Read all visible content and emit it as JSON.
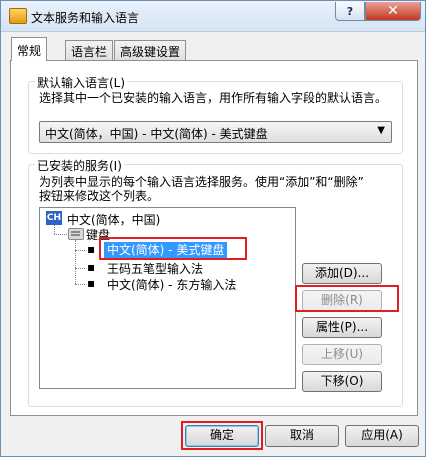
{
  "window": {
    "title": "文本服务和输入语言",
    "help_label": "?",
    "close_label": "✕"
  },
  "tabs": [
    {
      "label": "常规",
      "active": true
    },
    {
      "label": "语言栏",
      "active": false
    },
    {
      "label": "高级键设置",
      "active": false
    }
  ],
  "default_language": {
    "group_title": "默认输入语言(L)",
    "description": "选择其中一个已安装的输入语言，用作所有输入字段的默认语言。",
    "selected_value": "中文(简体，中国) - 中文(简体) - 美式键盘"
  },
  "installed_services": {
    "group_title": "已安装的服务(I)",
    "description_line1": "为列表中显示的每个输入语言选择服务。使用“添加”和“删除”",
    "description_line2": "按钮来修改这个列表。",
    "tree": {
      "language_badge": "CH",
      "language": "中文(简体，中国)",
      "category": "键盘",
      "items": [
        "中文(简体) - 美式键盘",
        "王码五笔型输入法",
        "中文(简体) - 东方输入法"
      ],
      "selected_index": 0
    },
    "buttons": {
      "add": "添加(D)...",
      "remove": "删除(R)",
      "properties": "属性(P)...",
      "move_up": "上移(U)",
      "move_down": "下移(O)"
    }
  },
  "footer": {
    "ok": "确定",
    "cancel": "取消",
    "apply": "应用(A)"
  },
  "colors": {
    "highlight_box": "#e02020",
    "selection": "#3399ff",
    "language_badge": "#2b63c6"
  }
}
